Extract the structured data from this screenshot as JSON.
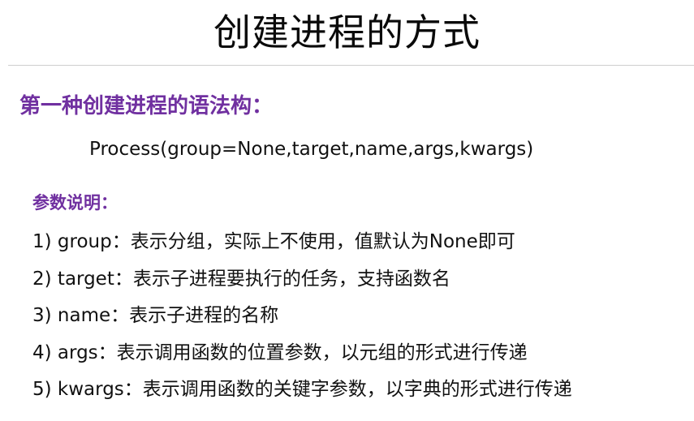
{
  "slide": {
    "title": "创建进程的方式",
    "section_heading": "第一种创建进程的语法构：",
    "signature": "Process(group=None,target,name,args,kwargs)",
    "params_heading": "参数说明：",
    "params": [
      {
        "num": "1)",
        "name": "group",
        "sep": "：",
        "desc": "表示分组，实际上不使用，值默认为None即可"
      },
      {
        "num": "2)",
        "name": "target",
        "sep": "：",
        "desc": "表示子进程要执行的任务，支持函数名"
      },
      {
        "num": "3)",
        "name": "name",
        "sep": "：",
        "desc": "表示子进程的名称"
      },
      {
        "num": "4)",
        "name": "args",
        "sep": "：",
        "desc": "表示调用函数的位置参数，以元组的形式进行传递"
      },
      {
        "num": "5)",
        "name": "kwargs",
        "sep": "：",
        "desc": "表示调用函数的关键字参数，以字典的形式进行传递"
      }
    ]
  },
  "colors": {
    "heading_purple": "#7030a0",
    "text": "#111111",
    "divider": "#cfcfcf"
  }
}
